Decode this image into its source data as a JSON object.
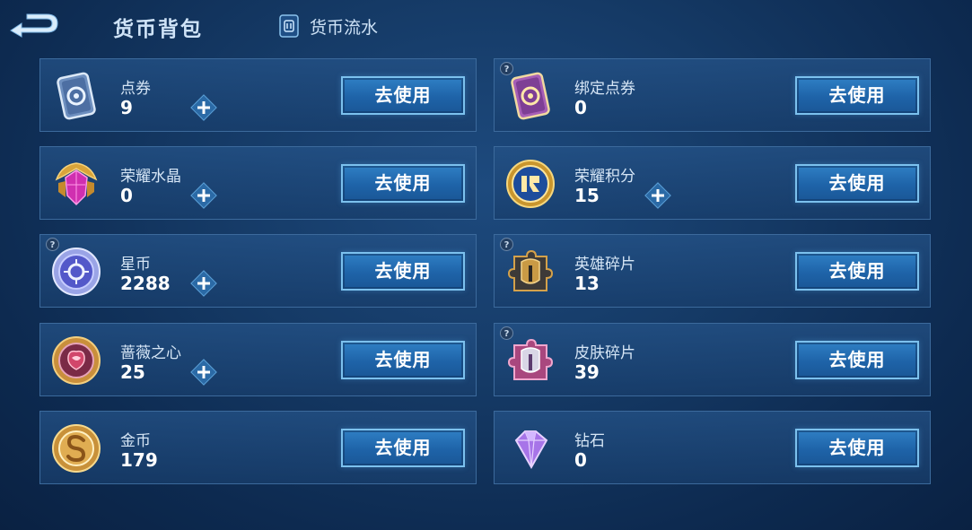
{
  "header": {
    "title": "货币背包",
    "flow_label": "货币流水"
  },
  "colors": {
    "background": "#153a66",
    "card_border": "#3c6a9c",
    "button": "#2570b6",
    "button_border": "#7cc1ee"
  },
  "currencies": [
    {
      "name": "点券",
      "amount": "9",
      "icon": "coupon-icon",
      "button": "去使用",
      "has_plus": true,
      "has_help": false
    },
    {
      "name": "绑定点券",
      "amount": "0",
      "icon": "bound-coupon-icon",
      "button": "去使用",
      "has_plus": false,
      "has_help": true
    },
    {
      "name": "荣耀水晶",
      "amount": "0",
      "icon": "glory-crystal-icon",
      "button": "去使用",
      "has_plus": true,
      "has_help": false
    },
    {
      "name": "荣耀积分",
      "amount": "15",
      "icon": "glory-points-icon",
      "button": "去使用",
      "has_plus": true,
      "has_help": false
    },
    {
      "name": "星币",
      "amount": "2288",
      "icon": "star-coin-icon",
      "button": "去使用",
      "has_plus": true,
      "has_help": true
    },
    {
      "name": "英雄碎片",
      "amount": "13",
      "icon": "hero-fragment-icon",
      "button": "去使用",
      "has_plus": false,
      "has_help": true
    },
    {
      "name": "蔷薇之心",
      "amount": "25",
      "icon": "rose-heart-icon",
      "button": "去使用",
      "has_plus": true,
      "has_help": false
    },
    {
      "name": "皮肤碎片",
      "amount": "39",
      "icon": "skin-fragment-icon",
      "button": "去使用",
      "has_plus": false,
      "has_help": true
    },
    {
      "name": "金币",
      "amount": "179",
      "icon": "gold-coin-icon",
      "button": "去使用",
      "has_plus": false,
      "has_help": false
    },
    {
      "name": "钻石",
      "amount": "0",
      "icon": "diamond-icon",
      "button": "去使用",
      "has_plus": false,
      "has_help": false
    }
  ]
}
